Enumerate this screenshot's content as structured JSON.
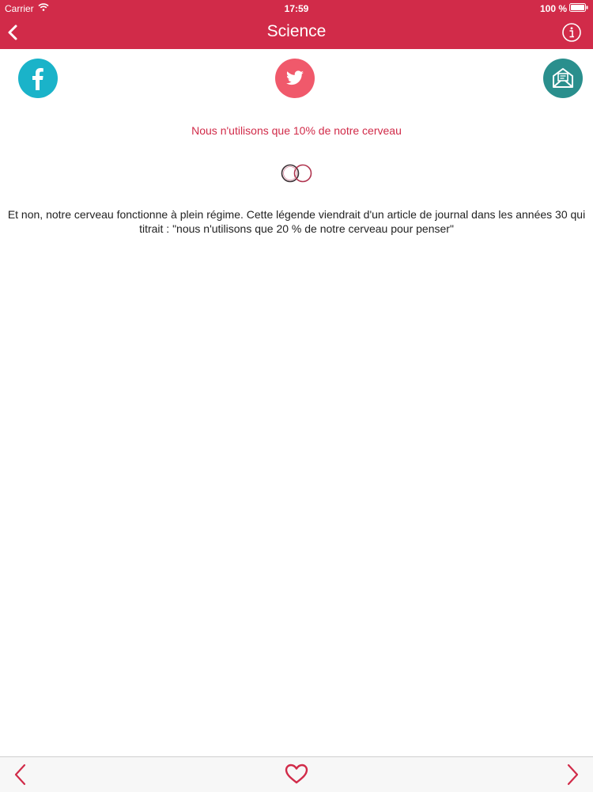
{
  "status_bar": {
    "carrier": "Carrier",
    "time": "17:59",
    "battery": "100 %",
    "icons": [
      "wifi-icon",
      "battery-icon"
    ]
  },
  "nav": {
    "title": "Science",
    "back_icon": "chevron-left-icon",
    "info_icon": "info-icon"
  },
  "share": {
    "buttons": [
      {
        "name": "facebook",
        "icon": "facebook-icon",
        "color": "#1ab3c9"
      },
      {
        "name": "twitter",
        "icon": "twitter-icon",
        "color": "#f0596b"
      },
      {
        "name": "email",
        "icon": "mail-icon",
        "color": "#2a8f8d"
      }
    ]
  },
  "article": {
    "headline": "Nous n'utilisons que 10% de notre cerveau",
    "divider_icon": "rings-icon",
    "body": "Et non, notre cerveau fonctionne à plein régime. Cette légende viendrait d'un article de journal dans les années 30 qui titrait : \"nous n'utilisons que 20 % de notre cerveau pour penser\""
  },
  "toolbar": {
    "prev_icon": "chevron-left-icon",
    "favorite_icon": "heart-icon",
    "next_icon": "chevron-right-icon"
  },
  "colors": {
    "accent": "#d12b49",
    "background": "#ffffff",
    "toolbar": "#f7f7f7"
  }
}
